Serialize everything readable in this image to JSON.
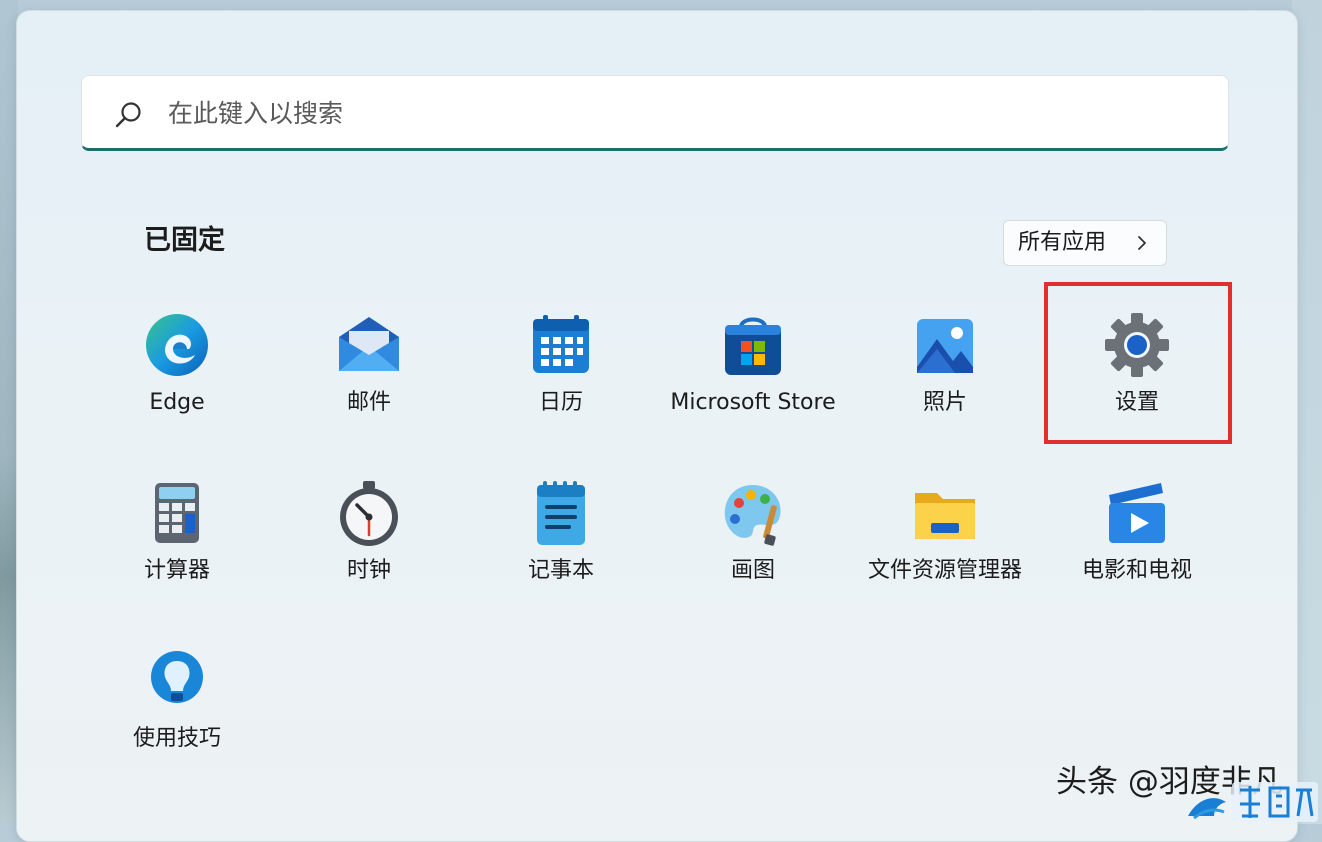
{
  "search": {
    "placeholder": "在此键入以搜索",
    "icon": "search-icon"
  },
  "pinned": {
    "title": "已固定",
    "all_apps_label": "所有应用",
    "all_apps_icon": "chevron-right-icon"
  },
  "apps": [
    {
      "label": "Edge",
      "icon": "edge-icon"
    },
    {
      "label": "邮件",
      "icon": "mail-icon"
    },
    {
      "label": "日历",
      "icon": "calendar-icon"
    },
    {
      "label": "Microsoft Store",
      "icon": "store-icon"
    },
    {
      "label": "照片",
      "icon": "photos-icon"
    },
    {
      "label": "设置",
      "icon": "settings-gear-icon",
      "highlighted": true
    },
    {
      "label": "计算器",
      "icon": "calculator-icon"
    },
    {
      "label": "时钟",
      "icon": "clock-icon"
    },
    {
      "label": "记事本",
      "icon": "notepad-icon"
    },
    {
      "label": "画图",
      "icon": "paint-palette-icon"
    },
    {
      "label": "文件资源管理器",
      "icon": "folder-icon"
    },
    {
      "label": "电影和电视",
      "icon": "movies-tv-icon"
    },
    {
      "label": "使用技巧",
      "icon": "tips-lightbulb-icon"
    }
  ],
  "highlight_color": "#e0302d",
  "watermark": {
    "text": "头条 @羽度非凡"
  }
}
